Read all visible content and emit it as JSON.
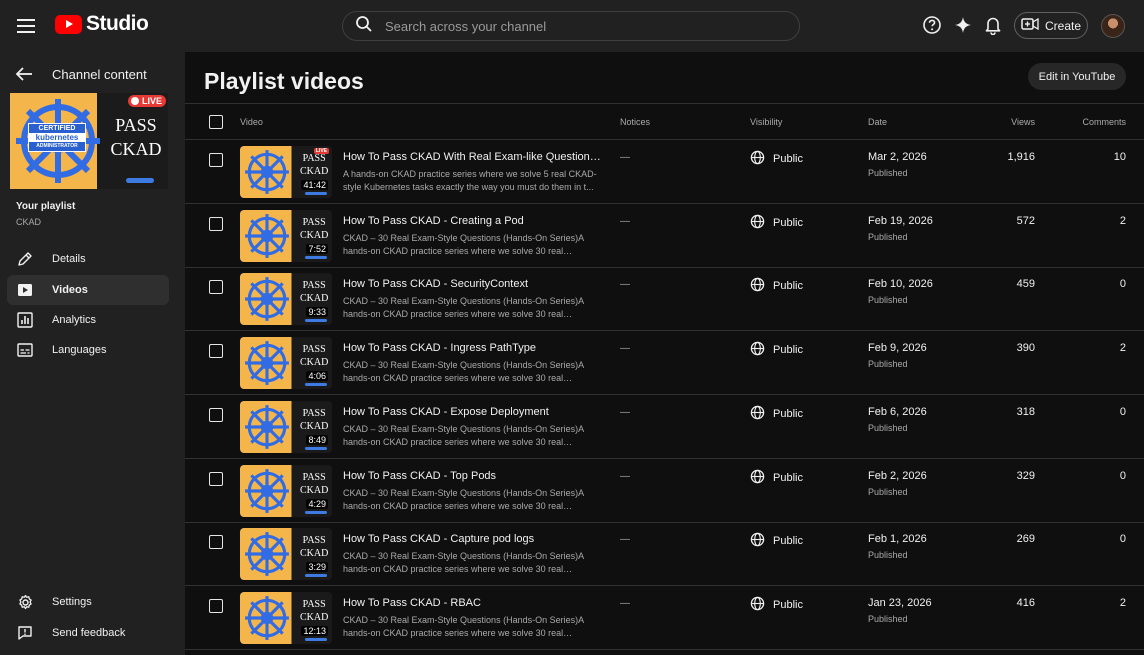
{
  "header": {
    "logo_text": "Studio",
    "search_placeholder": "Search across your channel",
    "create_label": "Create"
  },
  "sidebar": {
    "back_label": "Channel content",
    "thumb_pass": "PASS",
    "thumb_ckad": "CKAD",
    "thumb_live": "LIVE",
    "thumb_certified": "CERTIFIED",
    "thumb_kubernetes": "kubernetes",
    "thumb_admin": "ADMINISTRATOR",
    "your_playlist": "Your playlist",
    "playlist_name": "CKAD",
    "nav": [
      {
        "label": "Details",
        "icon": "pencil-icon"
      },
      {
        "label": "Videos",
        "icon": "video-icon"
      },
      {
        "label": "Analytics",
        "icon": "analytics-icon"
      },
      {
        "label": "Languages",
        "icon": "subtitles-icon"
      }
    ],
    "settings_label": "Settings",
    "feedback_label": "Send feedback"
  },
  "main": {
    "title": "Playlist videos",
    "edit_button": "Edit in YouTube",
    "columns": {
      "video": "Video",
      "notices": "Notices",
      "visibility": "Visibility",
      "date": "Date",
      "views": "Views",
      "comments": "Comments"
    },
    "rows": [
      {
        "duration": "41:42",
        "live": true,
        "title": "How To Pass CKAD With Real Exam-like Questions - ...",
        "desc": "A hands-on CKAD practice series where we solve 5 real CKAD-style Kubernetes tasks exactly the way you must do them in t...",
        "notice": "—",
        "visibility": "Public",
        "date": "Mar 2, 2026",
        "status": "Published",
        "views": "1,916",
        "comments": "10"
      },
      {
        "duration": "7:52",
        "live": false,
        "title": "How To Pass CKAD - Creating a Pod",
        "desc": "CKAD – 30 Real Exam-Style Questions (Hands-On Series)A hands-on CKAD practice series where we solve 30 real CKAD-...",
        "notice": "—",
        "visibility": "Public",
        "date": "Feb 19, 2026",
        "status": "Published",
        "views": "572",
        "comments": "2"
      },
      {
        "duration": "9:33",
        "live": false,
        "title": "How To Pass CKAD - SecurityContext",
        "desc": "CKAD – 30 Real Exam-Style Questions (Hands-On Series)A hands-on CKAD practice series where we solve 30 real CKAD-...",
        "notice": "—",
        "visibility": "Public",
        "date": "Feb 10, 2026",
        "status": "Published",
        "views": "459",
        "comments": "0"
      },
      {
        "duration": "4:06",
        "live": false,
        "title": "How To Pass CKAD - Ingress PathType",
        "desc": "CKAD – 30 Real Exam-Style Questions (Hands-On Series)A hands-on CKAD practice series where we solve 30 real CKAD-...",
        "notice": "—",
        "visibility": "Public",
        "date": "Feb 9, 2026",
        "status": "Published",
        "views": "390",
        "comments": "2"
      },
      {
        "duration": "8:49",
        "live": false,
        "title": "How To Pass CKAD - Expose Deployment",
        "desc": "CKAD – 30 Real Exam-Style Questions (Hands-On Series)A hands-on CKAD practice series where we solve 30 real CKAD-...",
        "notice": "—",
        "visibility": "Public",
        "date": "Feb 6, 2026",
        "status": "Published",
        "views": "318",
        "comments": "0"
      },
      {
        "duration": "4:29",
        "live": false,
        "title": "How To Pass CKAD - Top Pods",
        "desc": "CKAD – 30 Real Exam-Style Questions (Hands-On Series)A hands-on CKAD practice series where we solve 30 real CKAD-...",
        "notice": "—",
        "visibility": "Public",
        "date": "Feb 2, 2026",
        "status": "Published",
        "views": "329",
        "comments": "0"
      },
      {
        "duration": "3:29",
        "live": false,
        "title": "How To Pass CKAD - Capture pod logs",
        "desc": "CKAD – 30 Real Exam-Style Questions (Hands-On Series)A hands-on CKAD practice series where we solve 30 real CKAD-...",
        "notice": "—",
        "visibility": "Public",
        "date": "Feb 1, 2026",
        "status": "Published",
        "views": "269",
        "comments": "0"
      },
      {
        "duration": "12:13",
        "live": false,
        "title": "How To Pass CKAD - RBAC",
        "desc": "CKAD – 30 Real Exam-Style Questions (Hands-On Series)A hands-on CKAD practice series where we solve 30 real CKAD-...",
        "notice": "—",
        "visibility": "Public",
        "date": "Jan 23, 2026",
        "status": "Published",
        "views": "416",
        "comments": "2"
      }
    ]
  },
  "colors": {
    "brand": "#ff0000",
    "background": "#0f0f0f",
    "surface": "#212121",
    "thumb_yellow": "#f4b54a",
    "k8s_blue": "#326ce5"
  }
}
